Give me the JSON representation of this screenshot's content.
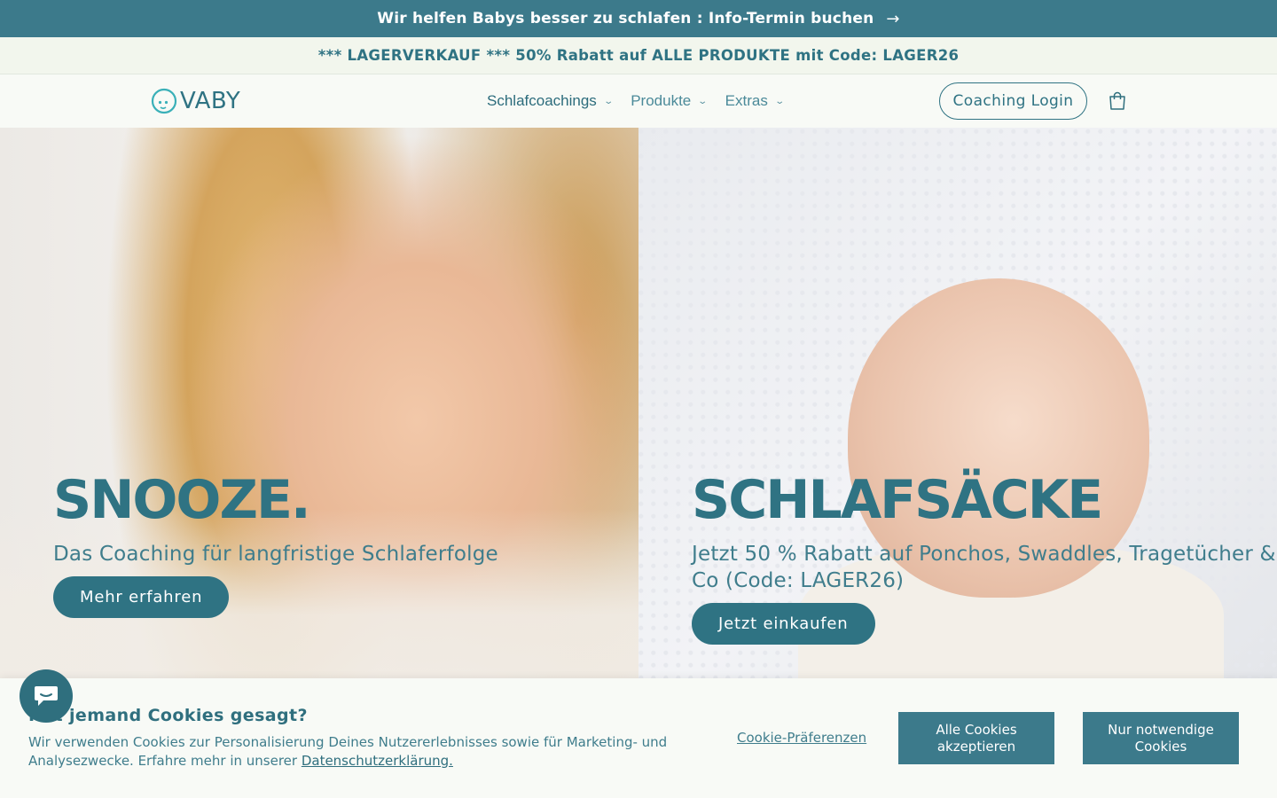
{
  "announcement": {
    "text": "Wir helfen Babys besser zu schlafen : Info-Termin buchen",
    "arrow": "→"
  },
  "promo": {
    "text": "*** LAGERVERKAUF *** 50% Rabatt auf ALLE PRODUKTE mit Code: LAGER26"
  },
  "header": {
    "logo_text": "VABY",
    "nav": [
      {
        "label": "Schlafcoachings"
      },
      {
        "label": "Produkte"
      },
      {
        "label": "Extras"
      }
    ],
    "coaching_login": "Coaching Login",
    "icons": {
      "cart": "cart-icon",
      "chevron": "chevron-down-icon",
      "logo": "logo-icon",
      "chat": "chat-icon"
    }
  },
  "hero": {
    "left": {
      "title": "SNOOZE.",
      "subtitle": "Das Coaching für langfristige Schlaferfolge",
      "button": "Mehr erfahren"
    },
    "right": {
      "title": "SCHLAFSÄCKE",
      "subtitle": "Jetzt 50 % Rabatt auf Ponchos, Swaddles, Tragetücher & Co (Code: LAGER26)",
      "button": "Jetzt einkaufen"
    }
  },
  "cookie": {
    "title": "Hat jemand Cookies gesagt?",
    "text": "Wir verwenden Cookies zur Personalisierung Deines Nutzererlebnisses sowie für Marketing- und Analysezwecke. Erfahre mehr in unserer ",
    "link": "Datenschutzerklärung.",
    "preferences": "Cookie-Präferenzen",
    "accept_all": "Alle Cookies akzeptieren",
    "necessary_only": "Nur notwendige Cookies"
  },
  "colors": {
    "primary": "#2f7383",
    "announcement_bg": "#3c7a8b",
    "page_bg": "#f6f9f3"
  }
}
